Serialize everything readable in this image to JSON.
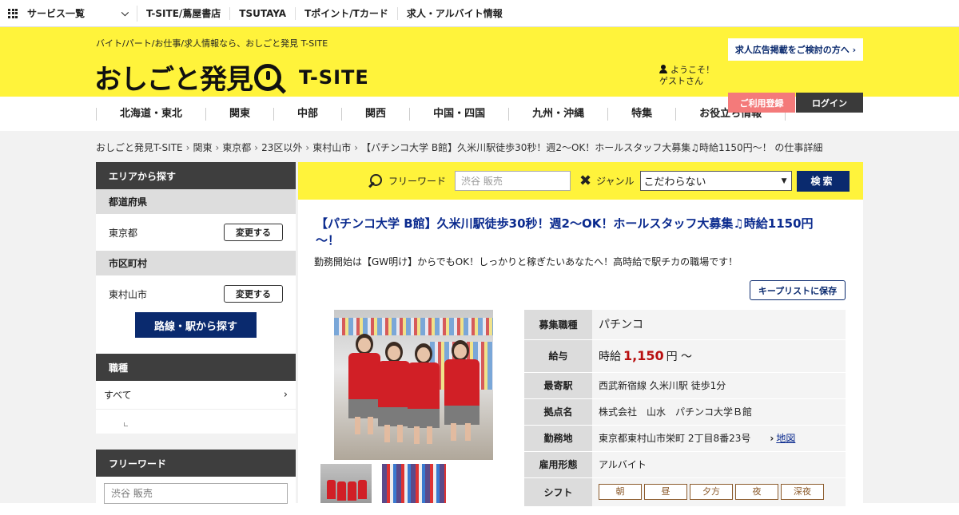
{
  "topbar": {
    "service_menu": "サービス一覧",
    "links": [
      "T-SITE/蔦屋書店",
      "TSUTAYA",
      "Tポイント/Tカード",
      "求人・アルバイト情報"
    ]
  },
  "header": {
    "tagline": "バイト/パート/お仕事/求人情報なら、おしごと発見 T-SITE",
    "logo_jp": "おしごと発見",
    "logo_en": "T-SITE",
    "ad_button": "求人広告掲載をご検討の方へ ›",
    "welcome_line1": "ようこそ！",
    "welcome_line2": "ゲストさん",
    "register": "ご利用登録",
    "login": "ログイン"
  },
  "nav": [
    "北海道・東北",
    "関東",
    "中部",
    "関西",
    "中国・四国",
    "九州・沖縄",
    "特集",
    "お役立ち情報"
  ],
  "breadcrumb": [
    "おしごと発見T-SITE",
    "関東",
    "東京都",
    "23区以外",
    "東村山市",
    "【パチンコ大学 B館】久米川駅徒歩30秒！週2～OK！ホールスタッフ大募集♫時給1150円～！ の仕事詳細"
  ],
  "sidebar": {
    "area_header": "エリアから探す",
    "pref_label": "都道府県",
    "pref_value": "東京都",
    "change": "変更する",
    "city_label": "市区町村",
    "city_value": "東村山市",
    "route_button": "路線・駅から探す",
    "job_header": "職種",
    "job_all": "すべて",
    "freeword_header": "フリーワード",
    "freeword_placeholder": "渋谷 販売"
  },
  "search": {
    "freeword_label": "フリーワード",
    "freeword_placeholder": "渋谷 販売",
    "genre_label": "ジャンル",
    "genre_value": "こだわらない",
    "button": "検索"
  },
  "job": {
    "title": "【パチンコ大学 B館】久米川駅徒歩30秒！週2～OK！ホールスタッフ大募集♫時給1150円～！",
    "subtitle": "勤務開始は【GW明け】からでもOK！しっかりと稼ぎたいあなたへ！高時給で駅チカの職場です！",
    "keep_button": "キープリストに保存",
    "spec": {
      "type_label": "募集職種",
      "type_value": "パチンコ",
      "wage_label": "給与",
      "wage_prefix": "時給",
      "wage_amount": "1,150",
      "wage_suffix": "円 〜",
      "station_label": "最寄駅",
      "station_value": "西武新宿線 久米川駅 徒歩1分",
      "base_label": "拠点名",
      "base_value": "株式会社　山水　パチンコ大学Ｂ館",
      "location_label": "勤務地",
      "location_value": "東京都東村山市栄町 2丁目8番23号",
      "map_link": "地図",
      "employment_label": "雇用形態",
      "employment_value": "アルバイト",
      "shift_label": "シフト",
      "shifts": [
        "朝",
        "昼",
        "夕方",
        "夜",
        "深夜"
      ]
    }
  },
  "colors": {
    "yellow": "#fff33b",
    "navy": "#0a2a6e",
    "wage_red": "#b80f10",
    "pink": "#f47a7a"
  }
}
